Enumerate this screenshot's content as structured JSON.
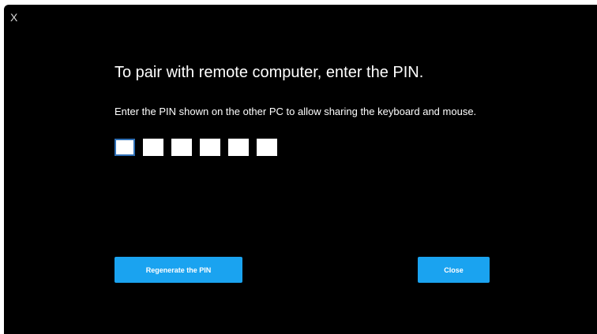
{
  "window": {
    "close_glyph": "X"
  },
  "content": {
    "title": "To pair with remote computer, enter the PIN.",
    "description": "Enter the PIN shown on the other PC to allow sharing the keyboard and mouse."
  },
  "pin": {
    "digits": [
      "",
      "",
      "",
      "",
      "",
      ""
    ],
    "active_index": 0
  },
  "buttons": {
    "regenerate_label": "Regenerate the PIN",
    "close_label": "Close"
  },
  "colors": {
    "background": "#000000",
    "accent": "#1aa3f0",
    "focus_border": "#2f6fb5"
  }
}
